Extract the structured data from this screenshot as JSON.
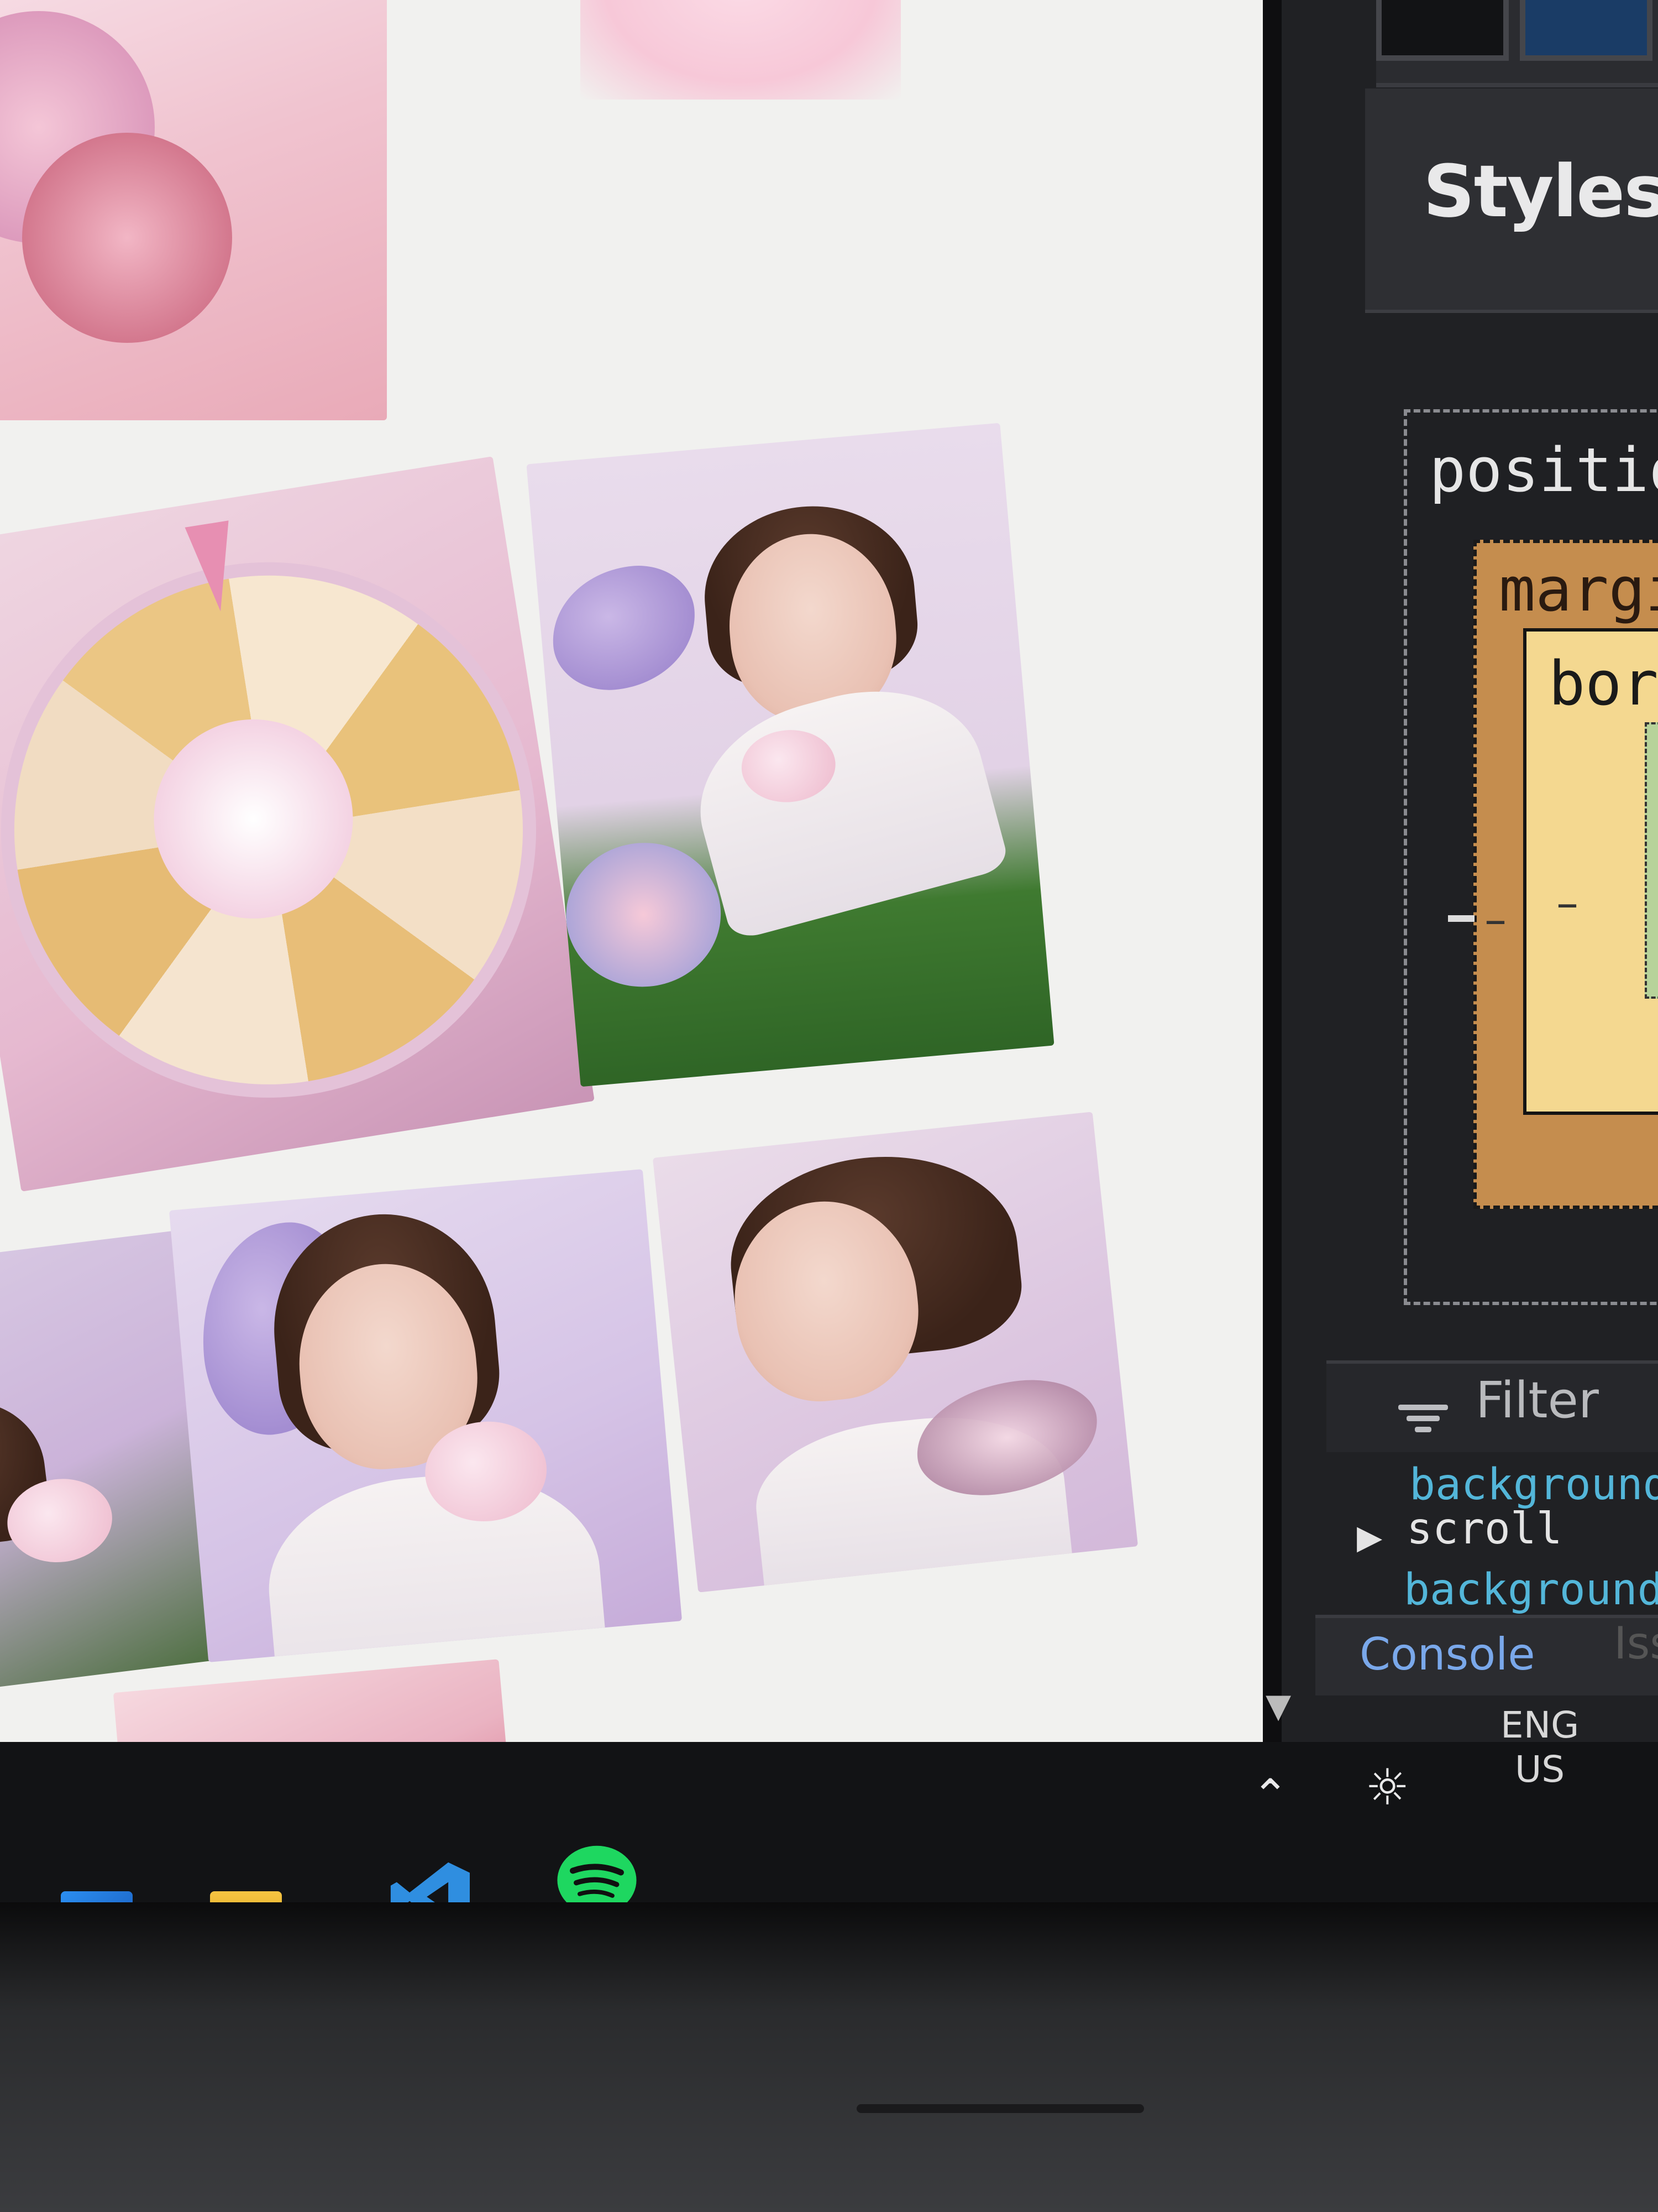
{
  "devtools": {
    "panel_title": "Styles",
    "box_model": {
      "position_label": "position",
      "margin_label": "margin",
      "border_label": "border",
      "dash": "–"
    },
    "filter_placeholder": "Filter",
    "rules": [
      {
        "prop": "background",
        "value": ""
      },
      {
        "prop": "",
        "value": "scroll"
      },
      {
        "prop": "background",
        "value": ""
      }
    ],
    "tabs": {
      "console": "Console",
      "issues": "Issues"
    }
  },
  "taskbar": {
    "apps": [
      "start",
      "file-explorer",
      "vs-code",
      "spotify"
    ],
    "tray": {
      "language": "ENG",
      "region": "US"
    }
  },
  "colors": {
    "page_bg": "#f1f1ef",
    "devtools_bg": "#202124",
    "css_property": "#53b6d9",
    "margin_box": "#c58d4e",
    "border_box": "#f4d890",
    "content_box": "#b7d39a",
    "console_tab": "#7aa8ea"
  },
  "gallery": {
    "tiles": [
      {
        "subject": "pink compact powder with floral background"
      },
      {
        "subject": "pink gradient cushion compact"
      },
      {
        "subject": "roulette wheel of cushion compacts"
      },
      {
        "subject": "model lying on grass with butterfly and flowers"
      },
      {
        "subject": "model with orchids holding compact"
      },
      {
        "subject": "model with purple flowers holding pink compact"
      },
      {
        "subject": "model with butterfly on shoulder"
      },
      {
        "subject": "hand holding pink compact with orchids"
      }
    ]
  }
}
